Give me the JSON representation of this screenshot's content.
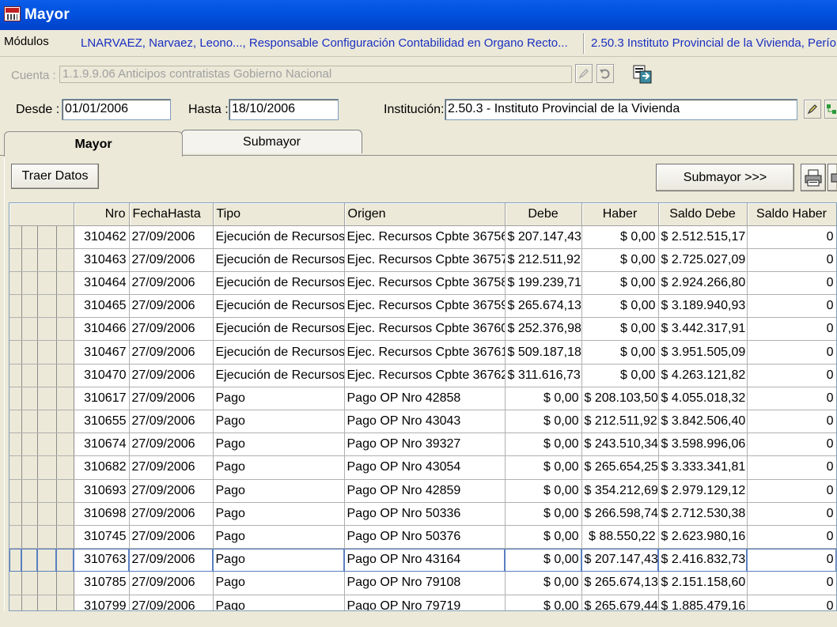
{
  "window": {
    "title": "Mayor"
  },
  "modules": {
    "label": "Módulos",
    "user": "LNARVAEZ, Narvaez, Leono..., Responsable Configuración Contabilidad en Organo Recto...",
    "institution": "2.50.3 Instituto Provincial de la Vivienda, Perío"
  },
  "cuenta": {
    "label": "Cuenta :",
    "value": "1.1.9.9.06 Anticipos contratistas Gobierno Nacional"
  },
  "filters": {
    "desde_label": "Desde :",
    "desde_value": "01/01/2006",
    "hasta_label": "Hasta :",
    "hasta_value": "18/10/2006",
    "institucion_label": "Institución:",
    "institucion_value": "2.50.3 - Instituto Provincial de la Vivienda"
  },
  "tabs": [
    {
      "label": "Mayor",
      "active": true
    },
    {
      "label": "Submayor",
      "active": false
    }
  ],
  "toolbar": {
    "traer_label": "Traer Datos",
    "submayor_label": "Submayor >>>"
  },
  "table": {
    "columns": [
      "Nro",
      "FechaHasta",
      "Tipo",
      "Origen",
      "Debe",
      "Haber",
      "Saldo Debe",
      "Saldo Haber"
    ],
    "rows": [
      [
        "310462",
        "27/09/2006",
        "Ejecución de Recursos",
        "Ejec. Recursos Cpbte 36756",
        "$ 207.147,43",
        "$ 0,00",
        "$ 2.512.515,17",
        "0"
      ],
      [
        "310463",
        "27/09/2006",
        "Ejecución de Recursos",
        "Ejec. Recursos Cpbte 36757",
        "$ 212.511,92",
        "$ 0,00",
        "$ 2.725.027,09",
        "0"
      ],
      [
        "310464",
        "27/09/2006",
        "Ejecución de Recursos",
        "Ejec. Recursos Cpbte 36758",
        "$ 199.239,71",
        "$ 0,00",
        "$ 2.924.266,80",
        "0"
      ],
      [
        "310465",
        "27/09/2006",
        "Ejecución de Recursos",
        "Ejec. Recursos Cpbte 36759",
        "$ 265.674,13",
        "$ 0,00",
        "$ 3.189.940,93",
        "0"
      ],
      [
        "310466",
        "27/09/2006",
        "Ejecución de Recursos",
        "Ejec. Recursos Cpbte 36760",
        "$ 252.376,98",
        "$ 0,00",
        "$ 3.442.317,91",
        "0"
      ],
      [
        "310467",
        "27/09/2006",
        "Ejecución de Recursos",
        "Ejec. Recursos Cpbte 36761",
        "$ 509.187,18",
        "$ 0,00",
        "$ 3.951.505,09",
        "0"
      ],
      [
        "310470",
        "27/09/2006",
        "Ejecución de Recursos",
        "Ejec. Recursos Cpbte 36762",
        "$ 311.616,73",
        "$ 0,00",
        "$ 4.263.121,82",
        "0"
      ],
      [
        "310617",
        "27/09/2006",
        "Pago",
        "Pago OP Nro  42858",
        "$ 0,00",
        "$ 208.103,50",
        "$ 4.055.018,32",
        "0"
      ],
      [
        "310655",
        "27/09/2006",
        "Pago",
        "Pago OP Nro  43043",
        "$ 0,00",
        "$ 212.511,92",
        "$ 3.842.506,40",
        "0"
      ],
      [
        "310674",
        "27/09/2006",
        "Pago",
        "Pago OP Nro  39327",
        "$ 0,00",
        "$ 243.510,34",
        "$ 3.598.996,06",
        "0"
      ],
      [
        "310682",
        "27/09/2006",
        "Pago",
        "Pago OP Nro  43054",
        "$ 0,00",
        "$ 265.654,25",
        "$ 3.333.341,81",
        "0"
      ],
      [
        "310693",
        "27/09/2006",
        "Pago",
        "Pago OP Nro  42859",
        "$ 0,00",
        "$ 354.212,69",
        "$ 2.979.129,12",
        "0"
      ],
      [
        "310698",
        "27/09/2006",
        "Pago",
        "Pago OP Nro  50336",
        "$ 0,00",
        "$ 266.598,74",
        "$ 2.712.530,38",
        "0"
      ],
      [
        "310745",
        "27/09/2006",
        "Pago",
        "Pago OP Nro  50376",
        "$ 0,00",
        "$ 88.550,22",
        "$ 2.623.980,16",
        "0"
      ],
      [
        "310763",
        "27/09/2006",
        "Pago",
        "Pago OP Nro  43164",
        "$ 0,00",
        "$ 207.147,43",
        "$ 2.416.832,73",
        "0"
      ],
      [
        "310785",
        "27/09/2006",
        "Pago",
        "Pago OP Nro  79108",
        "$ 0,00",
        "$ 265.674,13",
        "$ 2.151.158,60",
        "0"
      ],
      [
        "310799",
        "27/09/2006",
        "Pago",
        "Pago OP Nro  79719",
        "$ 0,00",
        "$ 265.679,44",
        "$ 1.885.479,16",
        "0"
      ]
    ],
    "selected_row": 14
  }
}
